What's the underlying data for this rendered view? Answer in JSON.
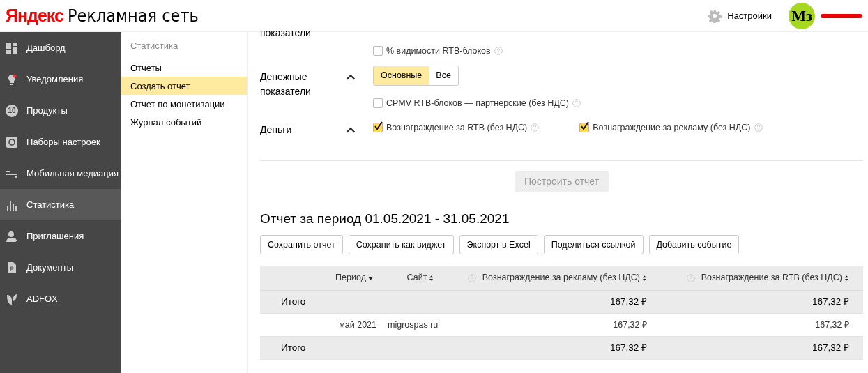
{
  "header": {
    "logo_brand": "Яндекс",
    "logo_product": "Рекламная сеть",
    "settings_label": "Настройки",
    "avatar_text": "Mз"
  },
  "sidebar": {
    "items": [
      {
        "label": "Дашборд",
        "selected": false
      },
      {
        "label": "Уведомления",
        "selected": false
      },
      {
        "label": "Продукты",
        "badge": "10",
        "selected": false
      },
      {
        "label": "Наборы настроек",
        "selected": false
      },
      {
        "label": "Мобильная медиация",
        "selected": false
      },
      {
        "label": "Статистика",
        "selected": true
      },
      {
        "label": "Приглашения",
        "selected": false
      },
      {
        "label": "Документы",
        "selected": false
      },
      {
        "label": "ADFOX",
        "selected": false
      }
    ]
  },
  "subnav": {
    "title": "Статистика",
    "items": [
      {
        "label": "Отчеты",
        "selected": false
      },
      {
        "label": "Создать отчет",
        "selected": true
      },
      {
        "label": "Отчет по монетизации",
        "selected": false
      },
      {
        "label": "Журнал событий",
        "selected": false
      }
    ]
  },
  "metric_groups": [
    {
      "title": "показатели",
      "options": [
        {
          "label": "% видимости RTB-блоков",
          "checked": false
        }
      ]
    },
    {
      "title": "Денежные показатели",
      "expanded": true,
      "toggle": [
        {
          "label": "Основные",
          "selected": true
        },
        {
          "label": "Все",
          "selected": false
        }
      ],
      "options": [
        {
          "label": "CPMV RTB-блоков — партнерские (без НДС)",
          "checked": false
        }
      ]
    },
    {
      "title": "Деньги",
      "expanded": true,
      "options": [
        {
          "label": "Вознаграждение за RTB (без НДС)",
          "checked": true
        },
        {
          "label": "Вознаграждение за рекламу (без НДС)",
          "checked": true
        }
      ]
    }
  ],
  "build_button": {
    "label": "Построить отчет",
    "disabled": true
  },
  "report": {
    "title": "Отчет за период 01.05.2021 - 31.05.2021",
    "actions": [
      "Сохранить отчет",
      "Сохранить как виджет",
      "Экспорт в Excel",
      "Поделиться ссылкой",
      "Добавить событие"
    ],
    "columns": [
      {
        "label": "Период",
        "sorted": true,
        "help": false
      },
      {
        "label": "Сайт",
        "sorted": false,
        "help": false
      },
      {
        "label": "Вознаграждение за рекламу (без НДС)",
        "sorted": false,
        "help": true
      },
      {
        "label": "Вознаграждение за RTB (без НДС)",
        "sorted": false,
        "help": true
      }
    ],
    "rows": [
      {
        "kind": "total",
        "label": "Итого",
        "ad_reward": "167,32 ₽",
        "rtb_reward": "167,32 ₽"
      },
      {
        "kind": "data",
        "period": "май 2021",
        "site": "migrospas.ru",
        "ad_reward": "167,32 ₽",
        "rtb_reward": "167,32 ₽"
      },
      {
        "kind": "total",
        "label": "Итого",
        "ad_reward": "167,32 ₽",
        "rtb_reward": "167,32 ₽"
      }
    ]
  }
}
